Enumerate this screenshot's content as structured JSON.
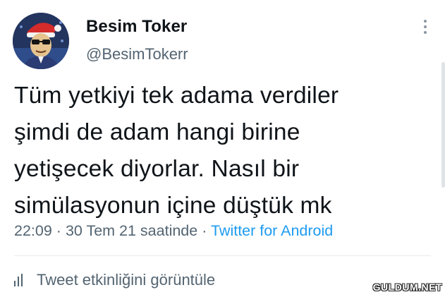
{
  "author": {
    "display_name": "Besim Toker",
    "handle": "@BesimTokerr"
  },
  "tweet": {
    "text": "Tüm yetkiyi tek adama verdiler\nşimdi de adam hangi birine\nyetişecek diyorlar. Nasıl bir\nsimülasyonun içine düştük mk",
    "time": "22:09",
    "date": "30 Tem 21 saatinde",
    "separator": "·",
    "source": "Twitter for Android"
  },
  "actions": {
    "analytics_label": "Tweet etkinliğini görüntüle"
  },
  "icons": {
    "more": "more-vertical-icon",
    "analytics": "bar-chart-icon",
    "avatar": "avatar-image"
  },
  "colors": {
    "text": "#0f1419",
    "secondary": "#536471",
    "link": "#1d9bf0"
  },
  "watermark": "GULDUM.NET"
}
